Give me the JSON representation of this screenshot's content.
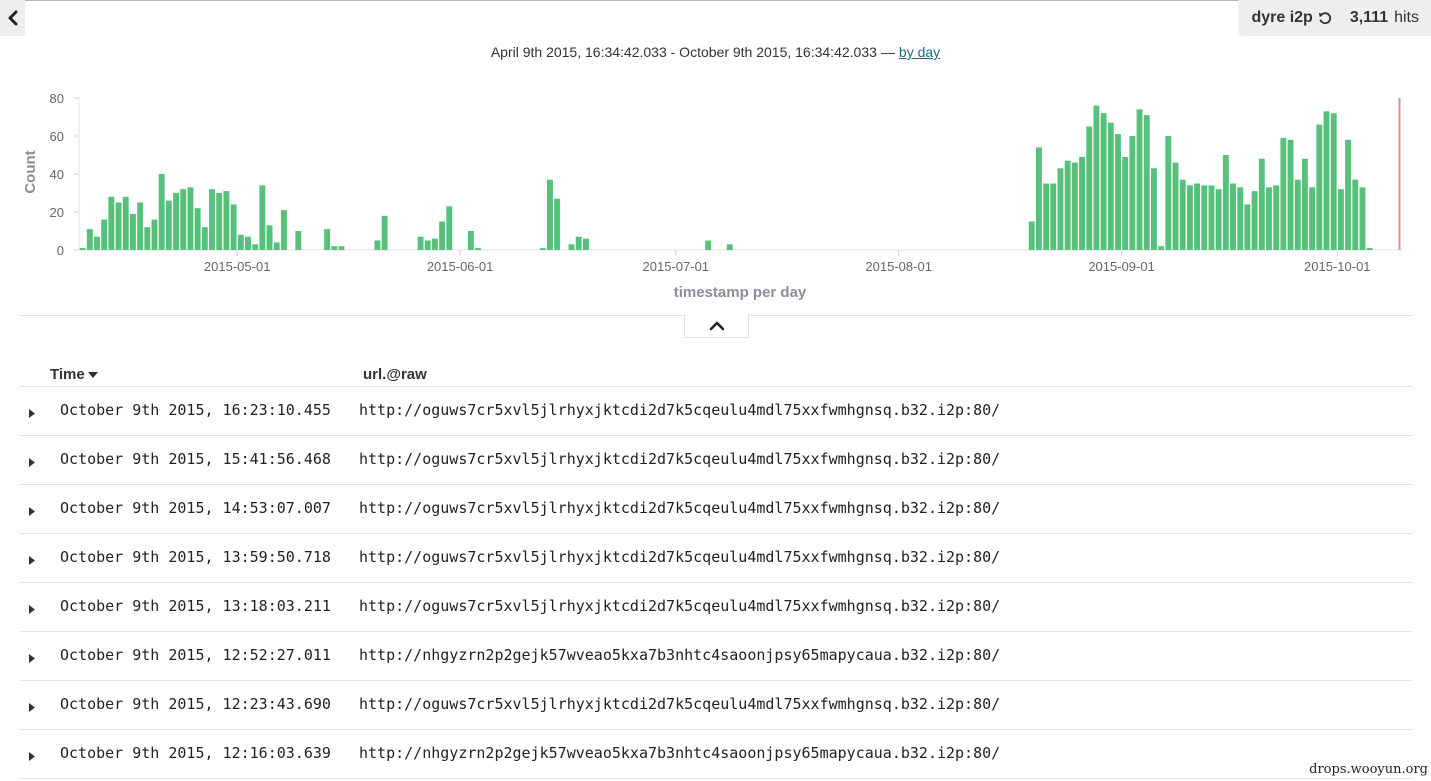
{
  "header": {
    "query": "dyre i2p",
    "hits_count": "3,111",
    "hits_label": "hits",
    "range_text": "April 9th 2015, 16:34:42.033 - October 9th 2015, 16:34:42.033",
    "range_sep": "—",
    "interval_link": "by day"
  },
  "icons": {
    "back": "chevron-left-icon",
    "reset": "undo-icon",
    "collapse": "chevron-up-icon",
    "sort": "caret-down-icon",
    "expand": "caret-right-icon"
  },
  "colors": {
    "bar": "#57c17b",
    "now_marker": "#e98d8d",
    "link": "#1f6b7a",
    "panel": "#eceeef"
  },
  "table": {
    "headers": {
      "time": "Time",
      "url": "url.@raw"
    },
    "rows": [
      {
        "time": "October 9th 2015, 16:23:10.455",
        "url": "http://oguws7cr5xvl5jlrhyxjktcdi2d7k5cqeulu4mdl75xxfwmhgnsq.b32.i2p:80/"
      },
      {
        "time": "October 9th 2015, 15:41:56.468",
        "url": "http://oguws7cr5xvl5jlrhyxjktcdi2d7k5cqeulu4mdl75xxfwmhgnsq.b32.i2p:80/"
      },
      {
        "time": "October 9th 2015, 14:53:07.007",
        "url": "http://oguws7cr5xvl5jlrhyxjktcdi2d7k5cqeulu4mdl75xxfwmhgnsq.b32.i2p:80/"
      },
      {
        "time": "October 9th 2015, 13:59:50.718",
        "url": "http://oguws7cr5xvl5jlrhyxjktcdi2d7k5cqeulu4mdl75xxfwmhgnsq.b32.i2p:80/"
      },
      {
        "time": "October 9th 2015, 13:18:03.211",
        "url": "http://oguws7cr5xvl5jlrhyxjktcdi2d7k5cqeulu4mdl75xxfwmhgnsq.b32.i2p:80/"
      },
      {
        "time": "October 9th 2015, 12:52:27.011",
        "url": "http://nhgyzrn2p2gejk57wveao5kxa7b3nhtc4saoonjpsy65mapycaua.b32.i2p:80/"
      },
      {
        "time": "October 9th 2015, 12:23:43.690",
        "url": "http://oguws7cr5xvl5jlrhyxjktcdi2d7k5cqeulu4mdl75xxfwmhgnsq.b32.i2p:80/"
      },
      {
        "time": "October 9th 2015, 12:16:03.639",
        "url": "http://nhgyzrn2p2gejk57wveao5kxa7b3nhtc4saoonjpsy65mapycaua.b32.i2p:80/"
      }
    ]
  },
  "watermark": "drops.wooyun.org",
  "chart_data": {
    "type": "bar",
    "xlabel": "timestamp per day",
    "ylabel": "Count",
    "ylim": [
      0,
      80
    ],
    "yticks": [
      0,
      20,
      40,
      60,
      80
    ],
    "xticks": [
      "2015-05-01",
      "2015-06-01",
      "2015-07-01",
      "2015-08-01",
      "2015-09-01",
      "2015-10-01"
    ],
    "x_range": [
      "2015-04-09",
      "2015-10-09"
    ],
    "grid": false,
    "x": [
      "2015-04-09",
      "2015-04-10",
      "2015-04-11",
      "2015-04-12",
      "2015-04-13",
      "2015-04-14",
      "2015-04-15",
      "2015-04-16",
      "2015-04-17",
      "2015-04-18",
      "2015-04-19",
      "2015-04-20",
      "2015-04-21",
      "2015-04-22",
      "2015-04-23",
      "2015-04-24",
      "2015-04-25",
      "2015-04-26",
      "2015-04-27",
      "2015-04-28",
      "2015-04-29",
      "2015-04-30",
      "2015-05-01",
      "2015-05-02",
      "2015-05-03",
      "2015-05-04",
      "2015-05-05",
      "2015-05-06",
      "2015-05-07",
      "2015-05-09",
      "2015-05-13",
      "2015-05-14",
      "2015-05-15",
      "2015-05-20",
      "2015-05-21",
      "2015-05-26",
      "2015-05-27",
      "2015-05-28",
      "2015-05-29",
      "2015-05-30",
      "2015-06-02",
      "2015-06-03",
      "2015-06-12",
      "2015-06-13",
      "2015-06-14",
      "2015-06-16",
      "2015-06-17",
      "2015-06-18",
      "2015-07-05",
      "2015-07-08",
      "2015-08-19",
      "2015-08-20",
      "2015-08-21",
      "2015-08-22",
      "2015-08-23",
      "2015-08-24",
      "2015-08-25",
      "2015-08-26",
      "2015-08-27",
      "2015-08-28",
      "2015-08-29",
      "2015-08-30",
      "2015-08-31",
      "2015-09-01",
      "2015-09-02",
      "2015-09-03",
      "2015-09-04",
      "2015-09-05",
      "2015-09-06",
      "2015-09-07",
      "2015-09-08",
      "2015-09-09",
      "2015-09-10",
      "2015-09-11",
      "2015-09-12",
      "2015-09-13",
      "2015-09-14",
      "2015-09-15",
      "2015-09-16",
      "2015-09-17",
      "2015-09-18",
      "2015-09-19",
      "2015-09-20",
      "2015-09-21",
      "2015-09-22",
      "2015-09-23",
      "2015-09-24",
      "2015-09-25",
      "2015-09-26",
      "2015-09-27",
      "2015-09-28",
      "2015-09-29",
      "2015-09-30",
      "2015-10-01",
      "2015-10-02",
      "2015-10-03",
      "2015-10-04",
      "2015-10-05",
      "2015-10-06",
      "2015-10-07",
      "2015-10-08",
      "2015-10-09"
    ],
    "values": [
      1,
      11,
      7,
      16,
      28,
      25,
      28,
      19,
      25,
      12,
      16,
      40,
      26,
      30,
      32,
      33,
      22,
      12,
      32,
      30,
      31,
      24,
      8,
      7,
      3,
      34,
      13,
      4,
      21,
      10,
      11,
      2,
      2,
      5,
      18,
      7,
      5,
      6,
      15,
      23,
      10,
      1,
      1,
      37,
      27,
      3,
      7,
      6,
      5,
      3,
      15,
      54,
      35,
      35,
      43,
      47,
      46,
      49,
      65,
      76,
      72,
      67,
      61,
      49,
      60,
      74,
      71,
      43,
      2,
      60,
      46,
      37,
      34,
      35,
      34,
      34,
      32,
      50,
      35,
      33,
      24,
      31,
      48,
      33,
      34,
      59,
      58,
      37,
      48,
      33,
      66,
      73,
      72,
      32,
      58,
      37,
      33,
      1
    ]
  }
}
